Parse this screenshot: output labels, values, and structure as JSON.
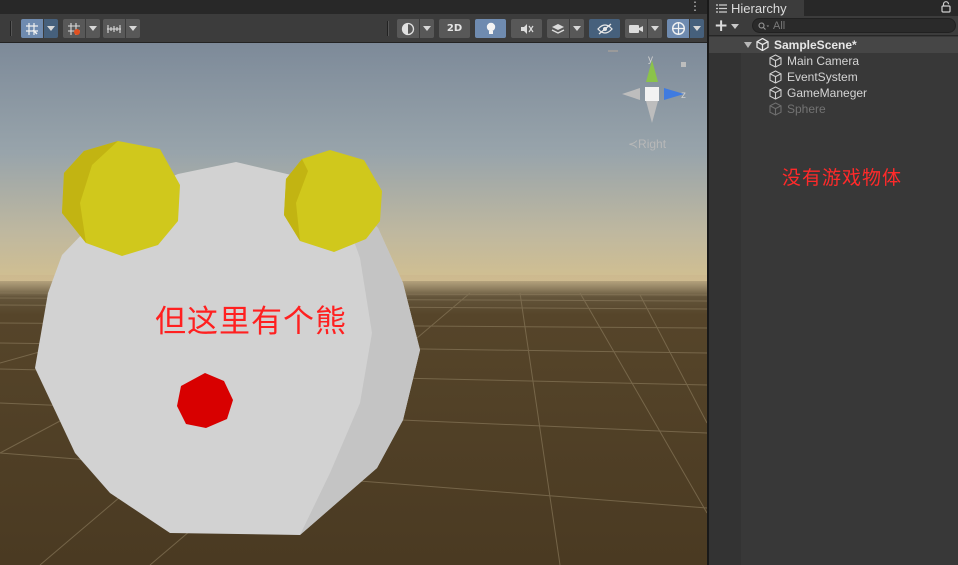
{
  "scene_view": {
    "menu_glyph": "⋮",
    "toolbar": {
      "left_tools": [
        {
          "name": "grid-snap-icon",
          "active": true,
          "dropdown": true
        },
        {
          "name": "snap-increment-icon",
          "active": false,
          "dropdown": true
        },
        {
          "name": "ruler-icon",
          "active": false,
          "dropdown": true
        }
      ],
      "right_tools": [
        {
          "name": "shading-mode-icon",
          "active": false,
          "dropdown": true
        },
        {
          "name": "2d-toggle",
          "label": "2D",
          "active": false,
          "dropdown": false
        },
        {
          "name": "lighting-toggle-icon",
          "active": true,
          "dropdown": false
        },
        {
          "name": "audio-mute-icon",
          "active": false,
          "dropdown": false
        },
        {
          "name": "effects-icon",
          "active": false,
          "dropdown": true
        },
        {
          "name": "visibility-icon",
          "active": true,
          "dropdown": false
        },
        {
          "name": "scene-camera-icon",
          "active": false,
          "dropdown": true
        },
        {
          "name": "gizmos-icon",
          "active": true,
          "dropdown": true
        }
      ]
    },
    "gizmo": {
      "y_label": "y",
      "z_label": "z",
      "view_label": "≺Right"
    },
    "overlay_text": "但这里有个熊",
    "colors": {
      "sky_top": "#7d8a99",
      "horizon": "#cdb98f",
      "ground": "#4a3a22",
      "bear_body": "#d2d2d2",
      "bear_ears": "#d0c81c",
      "bear_nose": "#d80000",
      "overlay_text": "#ff2020"
    }
  },
  "hierarchy": {
    "tab_label": "Hierarchy",
    "search_placeholder": "All",
    "add_label": "+",
    "scene": {
      "name": "SampleScene*"
    },
    "items": [
      {
        "label": "Main Camera",
        "enabled": true
      },
      {
        "label": "EventSystem",
        "enabled": true
      },
      {
        "label": "GameManeger",
        "enabled": true
      },
      {
        "label": "Sphere",
        "enabled": false
      }
    ],
    "note": "没有游戏物体",
    "colors": {
      "note": "#ff2a2a",
      "scene_row": "#464646",
      "panel": "#383838"
    }
  }
}
